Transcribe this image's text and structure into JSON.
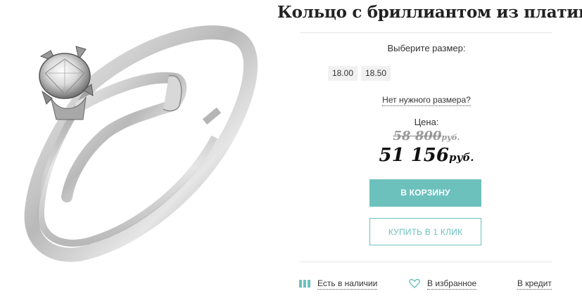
{
  "product": {
    "title": "Кольцо с бриллиантом из платины",
    "image_alt": "ring-photo"
  },
  "sizes": {
    "label": "Выберите размер:",
    "options": [
      "18.00",
      "18.50"
    ],
    "no_size_link": "Нет нужного размера?"
  },
  "price": {
    "label": "Цена:",
    "old_value": "58 800",
    "old_currency": "руб.",
    "new_value": "51 156",
    "new_currency": "руб."
  },
  "buttons": {
    "cart": "В КОРЗИНУ",
    "one_click": "КУПИТЬ В 1 КЛИК"
  },
  "bottom": {
    "stock": "Есть в наличии",
    "favorites": "В избранное",
    "credit": "В кредит"
  },
  "colors": {
    "accent": "#6cc1bd",
    "chip_bg": "#f1f1f1"
  },
  "icons": {
    "stock": "stock-bars-icon",
    "favorites": "heart-icon"
  }
}
